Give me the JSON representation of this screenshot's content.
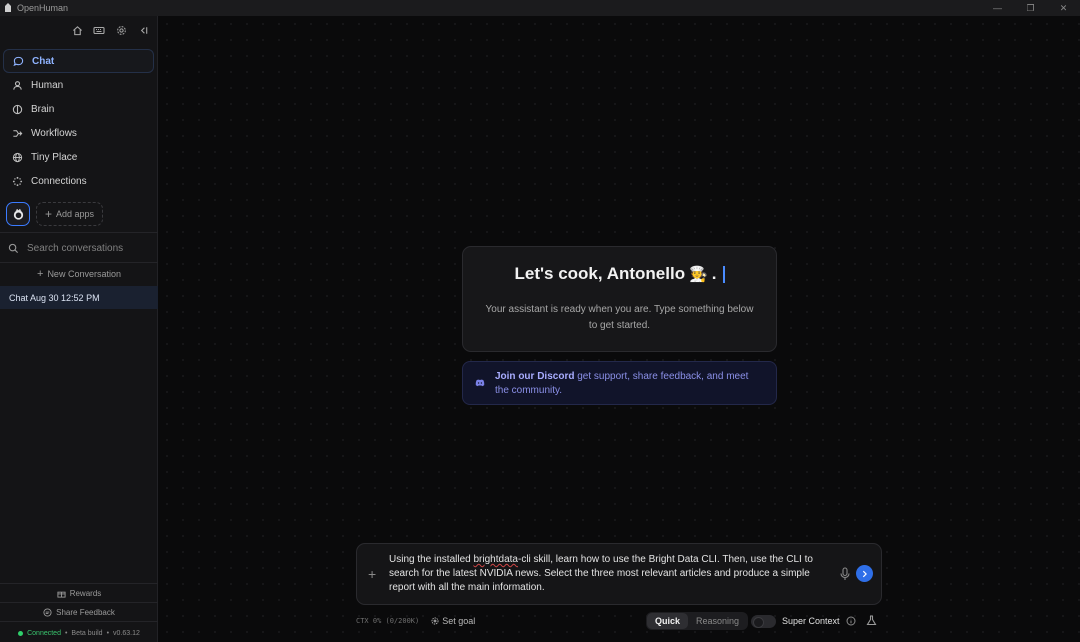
{
  "window": {
    "title": "OpenHuman",
    "controls": [
      "—",
      "❐",
      "✕"
    ]
  },
  "sidebar": {
    "nav": [
      {
        "label": "Chat",
        "icon": "chat-bubble-icon",
        "active": true
      },
      {
        "label": "Human",
        "icon": "user-icon"
      },
      {
        "label": "Brain",
        "icon": "brain-icon"
      },
      {
        "label": "Workflows",
        "icon": "workflow-icon"
      },
      {
        "label": "Tiny Place",
        "icon": "globe-icon"
      },
      {
        "label": "Connections",
        "icon": "connections-icon"
      }
    ],
    "add_apps": "Add apps",
    "search_placeholder": "Search conversations",
    "new_conversation": "New Conversation",
    "conversations": [
      "Chat Aug 30 12:52 PM"
    ],
    "rewards": "Rewards",
    "share_feedback": "Share Feedback",
    "status": {
      "connected": "Connected",
      "build": "Beta build",
      "version": "v0.63.12"
    }
  },
  "welcome": {
    "title": "Let's cook, Antonello",
    "emoji": "🧑‍🍳",
    "subtitle": "Your assistant is ready when you are. Type something below to get started."
  },
  "discord": {
    "link": "Join our Discord",
    "text": " get support, share feedback, and meet the community."
  },
  "composer": {
    "message_before": "Using the installed ",
    "message_error": "brightdata",
    "message_after": "-cli skill, learn how to use the Bright Data CLI. Then, use the CLI to search for the latest NVIDIA news. Select the three most relevant articles and produce a simple report with all the main information."
  },
  "toolbar": {
    "ctx": "CTX 0% (0/200K)",
    "set_goal": "Set goal",
    "modes": [
      "Quick",
      "Reasoning"
    ],
    "active_mode": "Quick",
    "super_context": "Super Context"
  }
}
